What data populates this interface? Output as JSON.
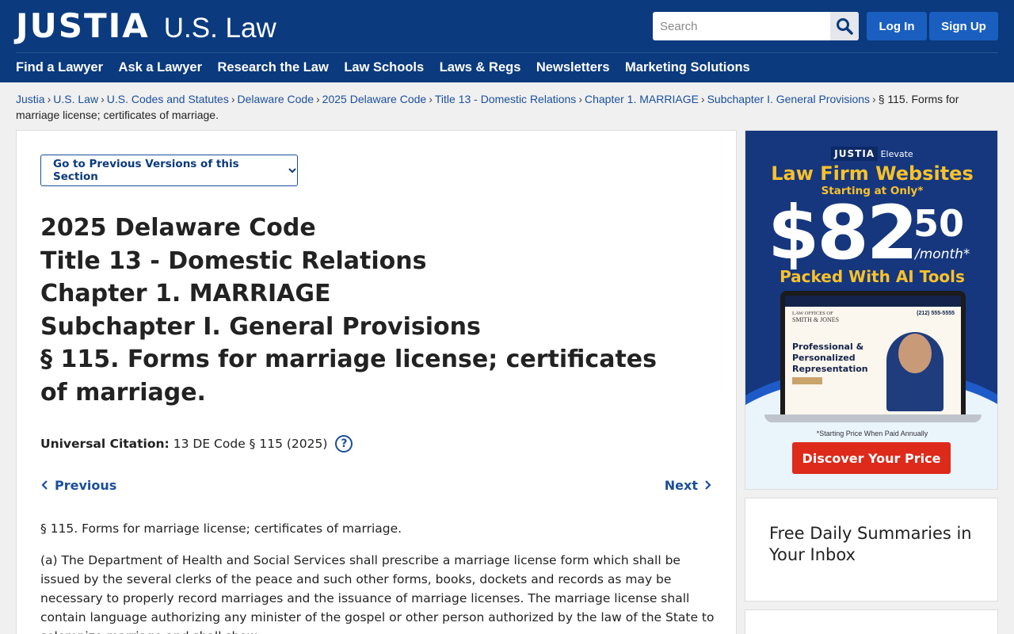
{
  "header": {
    "brand": "JUSTIA",
    "subbrand": "U.S. Law",
    "search_placeholder": "Search",
    "login_label": "Log In",
    "signup_label": "Sign Up",
    "bg_color": "#0b3a7e",
    "button_color": "#1a5fc0"
  },
  "nav": {
    "items": [
      {
        "label": "Find a Lawyer"
      },
      {
        "label": "Ask a Lawyer"
      },
      {
        "label": "Research the Law"
      },
      {
        "label": "Law Schools"
      },
      {
        "label": "Laws & Regs"
      },
      {
        "label": "Newsletters"
      },
      {
        "label": "Marketing Solutions"
      }
    ]
  },
  "breadcrumb": {
    "links": [
      "Justia",
      "U.S. Law",
      "U.S. Codes and Statutes",
      "Delaware Code",
      "2025 Delaware Code",
      "Title 13 - Domestic Relations",
      "Chapter 1. MARRIAGE",
      "Subchapter I. General Provisions"
    ],
    "separator": "›",
    "current": "§ 115. Forms for marriage license; certificates of marriage."
  },
  "main": {
    "versions_button": "Go to Previous Versions of this Section",
    "headings": [
      "2025 Delaware Code",
      "Title 13 - Domestic Relations",
      "Chapter 1. MARRIAGE",
      "Subchapter I. General Provisions",
      "§ 115. Forms for marriage license; certificates of marriage."
    ],
    "citation_label": "Universal Citation:",
    "citation_value": "13 DE Code § 115 (2025)",
    "citation_help": "?",
    "prev_label": "Previous",
    "next_label": "Next",
    "section_title": "§ 115. Forms for marriage license; certificates of marriage.",
    "paragraph_a": "(a) The Department of Health and Social Services shall prescribe a marriage license form which shall be issued by the several clerks of the peace and such other forms, books, dockets and records as may be necessary to properly record marriages and the issuance of marriage licenses. The marriage license shall contain language authorizing any minister of the gospel or other person authorized by the law of the State to solemnize marriage and shall show:"
  },
  "ad": {
    "brand": "JUSTIA",
    "brand_suffix": "Elevate",
    "title": "Law Firm Websites",
    "subtitle": "Starting at Only*",
    "price_main": "$82",
    "price_cents": "50",
    "per_month": "/month*",
    "tagline": "Packed With AI Tools",
    "screen_firm_prefix": "LAW OFFICES OF",
    "screen_firm_name": "SMITH & JONES",
    "screen_phone": "(212) 555-5555",
    "screen_hero": "Professional & Personalized Representation",
    "note": "*Starting Price When Paid Annually",
    "cta": "Discover Your Price",
    "accent_color": "#f9c12c",
    "cta_color": "#dd2a1b"
  },
  "sidebar": {
    "newsletter_title": "Free Daily Summaries in Your Inbox"
  }
}
